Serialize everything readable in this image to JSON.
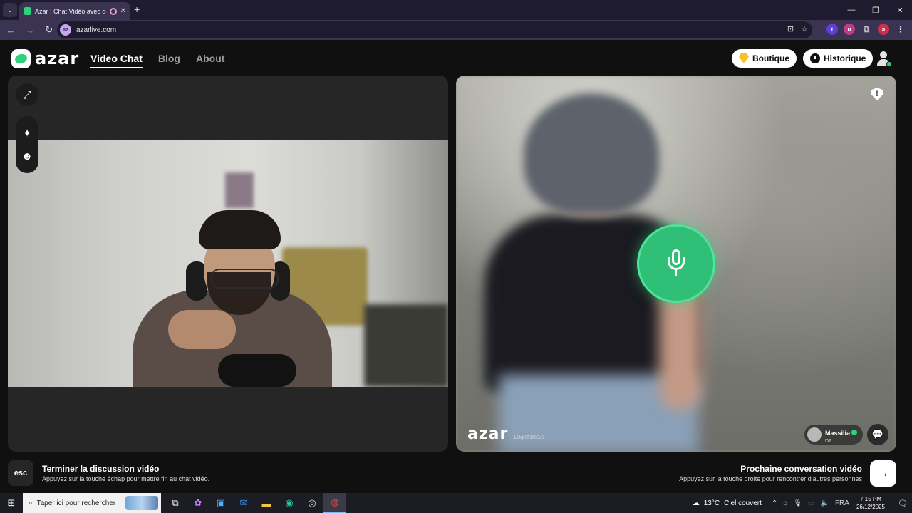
{
  "browser": {
    "tab_title": "Azar : Chat Vidéo avec de n",
    "tab_close": "✕",
    "new_tab": "+",
    "window_controls": [
      "—",
      "❐",
      "✕"
    ],
    "url": "azarlive.com",
    "site_badge": "az",
    "extensions": [
      {
        "label": "t",
        "color": "#5b3fd6"
      },
      {
        "label": "u",
        "color": "#c23a8a"
      },
      {
        "label": "a",
        "color": "#d02f4b"
      }
    ]
  },
  "header": {
    "brand": "azar",
    "nav": {
      "video_chat": "Video Chat",
      "blog": "Blog",
      "about": "About"
    },
    "boutique": "Boutique",
    "historique": "Historique"
  },
  "remote": {
    "watermark": "azar",
    "watermark_id": "LUqKT1RDs7",
    "peer_name": "Massilia",
    "peer_country": "DZ",
    "report_symbol": "!"
  },
  "bottom": {
    "esc_key": "esc",
    "end_title": "Terminer la discussion vidéo",
    "end_hint": "Appuyez sur la touche échap pour mettre fin au chat vidéo.",
    "next_title": "Prochaine conversation vidéo",
    "next_hint": "Appuyez sur la touche droite pour rencontrer d'autres personnes",
    "next_arrow": "→"
  },
  "taskbar": {
    "search_placeholder": "Taper ici pour rechercher",
    "weather_temp": "13°C",
    "weather_text": "Ciel couvert",
    "language": "FRA",
    "time": "7:15 PM",
    "date": "26/12/2025"
  },
  "colors": {
    "accent": "#2fd27a",
    "tab_bg": "#3a3352",
    "chrome_bg": "#1f1b2e"
  }
}
